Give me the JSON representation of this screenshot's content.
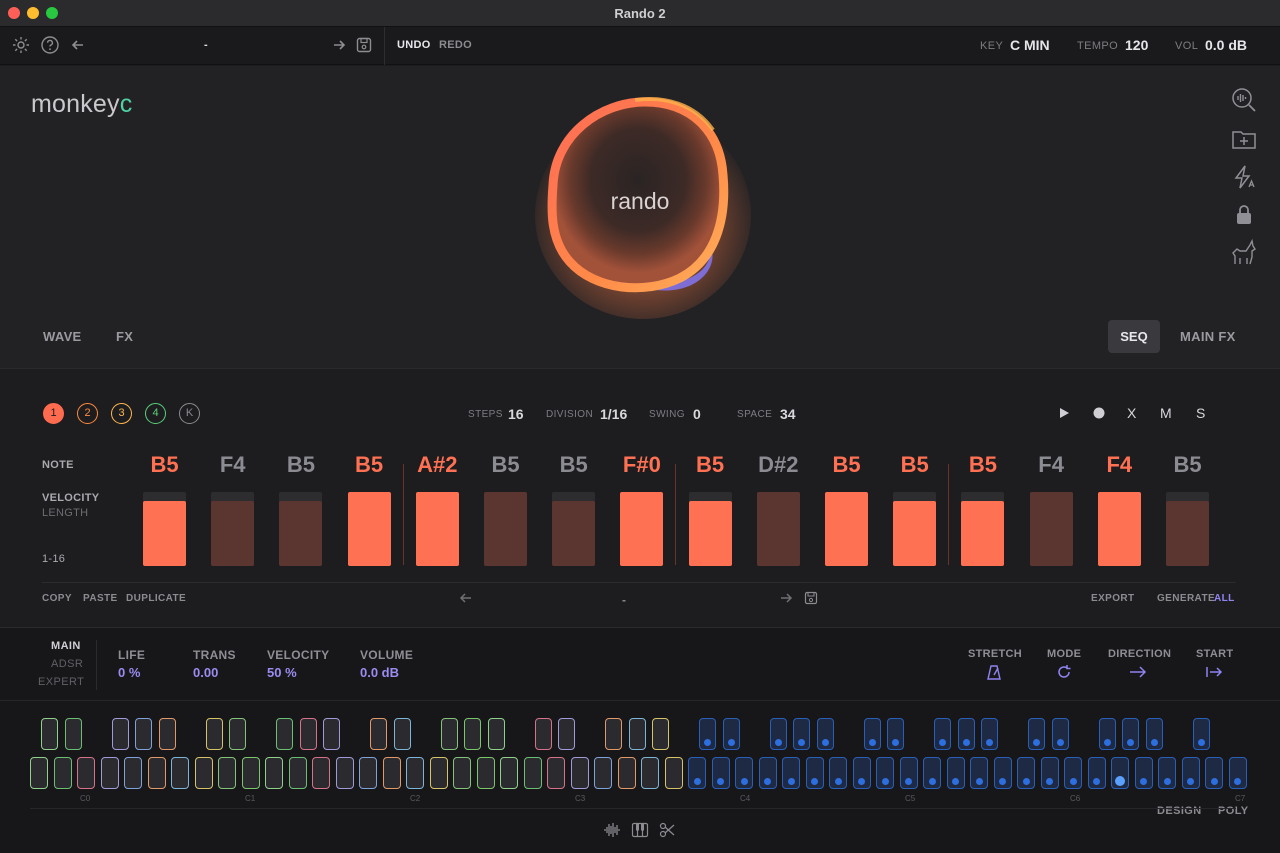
{
  "window": {
    "title": "Rando 2"
  },
  "toolbar": {
    "preset_name": "-",
    "undo": "UNDO",
    "redo": "REDO",
    "key_label": "KEY",
    "key_value": "C MIN",
    "tempo_label": "TEMPO",
    "tempo_value": "120",
    "vol_label": "VOL",
    "vol_value": "0.0 dB"
  },
  "hero": {
    "logo_main": "monkey",
    "logo_accent": "c",
    "orb_label": "rando",
    "left_tabs": [
      "WAVE",
      "FX"
    ],
    "right_tabs": [
      "SEQ",
      "MAIN FX"
    ],
    "side_icons": [
      "analyzer-icon",
      "add-folder-icon",
      "auto-flash-icon",
      "lock-icon",
      "unicorn-icon"
    ]
  },
  "sequencer": {
    "patterns": [
      {
        "label": "1",
        "color": "#ff6b4f",
        "active": true
      },
      {
        "label": "2",
        "color": "#ff8a3d",
        "active": false
      },
      {
        "label": "3",
        "color": "#ffb74d",
        "active": false
      },
      {
        "label": "4",
        "color": "#5ad17a",
        "active": false
      },
      {
        "label": "K",
        "color": "#8b8b90",
        "active": false
      }
    ],
    "steps_label": "STEPS",
    "steps_value": "16",
    "division_label": "DIVISION",
    "division_value": "1/16",
    "swing_label": "SWING",
    "swing_value": "0",
    "space_label": "SPACE",
    "space_value": "34",
    "transport": [
      "X",
      "M",
      "S"
    ],
    "row_note": "NOTE",
    "row_velocity": "VELOCITY",
    "row_length": "LENGTH",
    "row_range": "1-16",
    "steps": [
      {
        "note": "B5",
        "active": true,
        "vel": 0.88
      },
      {
        "note": "F4",
        "active": false,
        "vel": 0.88
      },
      {
        "note": "B5",
        "active": false,
        "vel": 0.88
      },
      {
        "note": "B5",
        "active": true,
        "vel": 1.0
      },
      {
        "note": "A#2",
        "active": true,
        "vel": 1.0
      },
      {
        "note": "B5",
        "active": false,
        "vel": 1.0
      },
      {
        "note": "B5",
        "active": false,
        "vel": 0.88
      },
      {
        "note": "F#0",
        "active": true,
        "vel": 1.0
      },
      {
        "note": "B5",
        "active": true,
        "vel": 0.88
      },
      {
        "note": "D#2",
        "active": false,
        "vel": 1.0
      },
      {
        "note": "B5",
        "active": true,
        "vel": 1.0
      },
      {
        "note": "B5",
        "active": true,
        "vel": 0.88
      },
      {
        "note": "B5",
        "active": true,
        "vel": 0.88
      },
      {
        "note": "F4",
        "active": false,
        "vel": 1.0
      },
      {
        "note": "F4",
        "active": true,
        "vel": 1.0
      },
      {
        "note": "B5",
        "active": false,
        "vel": 0.88
      }
    ],
    "copy": "COPY",
    "paste": "PASTE",
    "duplicate": "DUPLICATE",
    "pattern_preset": "-",
    "export": "EXPORT",
    "generate": "GENERATE",
    "generate_scope": "ALL"
  },
  "bottom": {
    "modes": [
      "MAIN",
      "ADSR",
      "EXPERT"
    ],
    "params": [
      {
        "label": "LIFE",
        "value": "0 %"
      },
      {
        "label": "TRANS",
        "value": "0.00"
      },
      {
        "label": "VELOCITY",
        "value": "50 %"
      },
      {
        "label": "VOLUME",
        "value": "0.0 dB"
      }
    ],
    "right_params": [
      "STRETCH",
      "MODE",
      "DIRECTION",
      "START"
    ],
    "octaves": [
      "C0",
      "C1",
      "C2",
      "C3",
      "C4",
      "C5",
      "C6",
      "C7"
    ],
    "design": "DESIGN",
    "poly": "POLY",
    "footer_icons": [
      "waveform-icon",
      "piano-icon",
      "scissors-icon"
    ]
  }
}
